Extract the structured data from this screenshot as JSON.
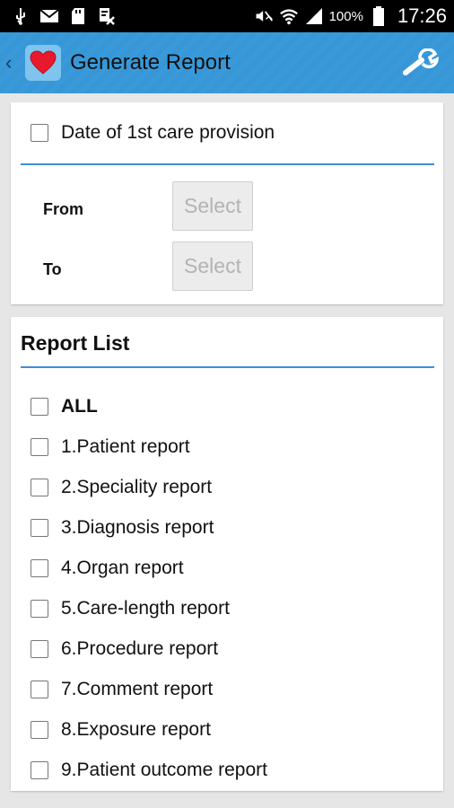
{
  "status_bar": {
    "battery_pct": "100%",
    "time": "17:26",
    "icons": [
      "usb-icon",
      "mail-icon",
      "sd-card-icon",
      "notification-icon",
      "mute-icon",
      "wifi-icon",
      "signal-icon",
      "battery-icon"
    ]
  },
  "action_bar": {
    "title": "Generate Report",
    "back_glyph": "‹",
    "accent": "#3a9ad9"
  },
  "date_section": {
    "checkbox_label": "Date of 1st care provision",
    "from_label": "From",
    "to_label": "To",
    "from_button": "Select",
    "to_button": "Select"
  },
  "report_list": {
    "title": "Report List",
    "items": [
      {
        "label": "ALL"
      },
      {
        "label": "1.Patient report"
      },
      {
        "label": "2.Speciality report"
      },
      {
        "label": "3.Diagnosis report"
      },
      {
        "label": "4.Organ report"
      },
      {
        "label": "5.Care-length report"
      },
      {
        "label": "6.Procedure report"
      },
      {
        "label": "7.Comment report"
      },
      {
        "label": "8.Exposure report"
      },
      {
        "label": "9.Patient outcome report"
      }
    ]
  }
}
